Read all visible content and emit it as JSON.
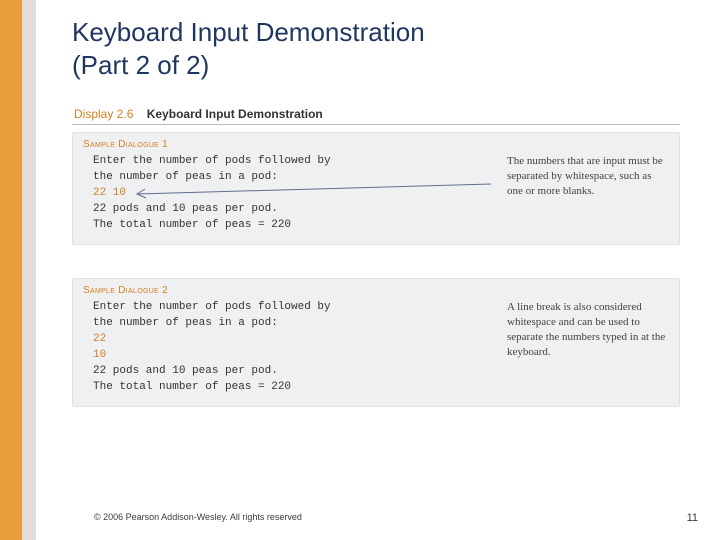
{
  "title_line1": "Keyboard Input Demonstration",
  "title_line2": "(Part 2 of 2)",
  "display": {
    "num": "Display 2.6",
    "name": "Keyboard Input Demonstration"
  },
  "sample1": {
    "label": "Sample Dialogue 1",
    "line1": "Enter the number of pods followed by",
    "line2": "the number of peas in a pod:",
    "input": "22 10",
    "line4": "22 pods and 10 peas per pod.",
    "line5": "The total number of peas = 220",
    "note": "The numbers that are input must be separated by whitespace, such as one or more blanks."
  },
  "sample2": {
    "label": "Sample Dialogue 2",
    "line1": "Enter the number of pods followed by",
    "line2": "the number of peas in a pod:",
    "input_a": "22",
    "input_b": "10",
    "line5": "22 pods and 10 peas per pod.",
    "line6": "The total number of peas = 220",
    "note": "A line break is also considered whitespace and can be used to separate the numbers typed in at the keyboard."
  },
  "footer": {
    "copyright": "© 2006 Pearson Addison-Wesley. All rights reserved",
    "page": "11"
  }
}
